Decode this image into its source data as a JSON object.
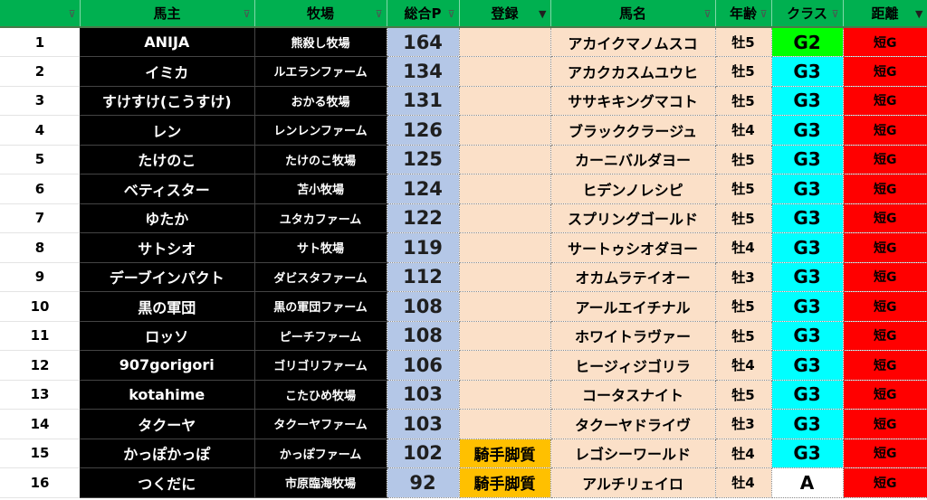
{
  "headers": [
    {
      "label": "",
      "filter": "normal"
    },
    {
      "label": "馬主",
      "filter": "normal"
    },
    {
      "label": "牧場",
      "filter": "normal"
    },
    {
      "label": "総合P",
      "filter": "normal"
    },
    {
      "label": "登録",
      "filter": "active"
    },
    {
      "label": "馬名",
      "filter": "normal"
    },
    {
      "label": "年齢",
      "filter": "normal"
    },
    {
      "label": "クラス",
      "filter": "normal"
    },
    {
      "label": "距離",
      "filter": "active"
    }
  ],
  "filter_icons": {
    "normal": "⊽",
    "active": "▼"
  },
  "class_colors": {
    "G2": "#00ff00",
    "G3": "#00ffff",
    "A": "#ffffff"
  },
  "rows": [
    {
      "idx": "1",
      "owner": "ANIJA",
      "farm": "熊殺し牧場",
      "points": "164",
      "registration": "",
      "horse": "アカイクマノムスコ",
      "age": "牡5",
      "class": "G2",
      "distance": "短G"
    },
    {
      "idx": "2",
      "owner": "イミカ",
      "farm": "ルエランファーム",
      "points": "134",
      "registration": "",
      "horse": "アカクカスムユウヒ",
      "age": "牡5",
      "class": "G3",
      "distance": "短G"
    },
    {
      "idx": "3",
      "owner": "すけすけ(こうすけ)",
      "farm": "おかる牧場",
      "points": "131",
      "registration": "",
      "horse": "ササキキングマコト",
      "age": "牡5",
      "class": "G3",
      "distance": "短G"
    },
    {
      "idx": "4",
      "owner": "レン",
      "farm": "レンレンファーム",
      "points": "126",
      "registration": "",
      "horse": "ブラッククラージュ",
      "age": "牡4",
      "class": "G3",
      "distance": "短G"
    },
    {
      "idx": "5",
      "owner": "たけのこ",
      "farm": "たけのこ牧場",
      "points": "125",
      "registration": "",
      "horse": "カーニバルダヨー",
      "age": "牡5",
      "class": "G3",
      "distance": "短G"
    },
    {
      "idx": "6",
      "owner": "ベティスター",
      "farm": "苫小牧場",
      "points": "124",
      "registration": "",
      "horse": "ヒデンノレシピ",
      "age": "牡5",
      "class": "G3",
      "distance": "短G"
    },
    {
      "idx": "7",
      "owner": "ゆたか",
      "farm": "ユタカファーム",
      "points": "122",
      "registration": "",
      "horse": "スプリングゴールド",
      "age": "牡5",
      "class": "G3",
      "distance": "短G"
    },
    {
      "idx": "8",
      "owner": "サトシオ",
      "farm": "サト牧場",
      "points": "119",
      "registration": "",
      "horse": "サートゥシオダヨー",
      "age": "牡4",
      "class": "G3",
      "distance": "短G"
    },
    {
      "idx": "9",
      "owner": "デーブインパクト",
      "farm": "ダビスタファーム",
      "points": "112",
      "registration": "",
      "horse": "オカムラテイオー",
      "age": "牡3",
      "class": "G3",
      "distance": "短G"
    },
    {
      "idx": "10",
      "owner": "黒の軍団",
      "farm": "黒の軍団ファーム",
      "points": "108",
      "registration": "",
      "horse": "アールエイチナル",
      "age": "牡5",
      "class": "G3",
      "distance": "短G"
    },
    {
      "idx": "11",
      "owner": "ロッソ",
      "farm": "ピーチファーム",
      "points": "108",
      "registration": "",
      "horse": "ホワイトラヴァー",
      "age": "牡5",
      "class": "G3",
      "distance": "短G"
    },
    {
      "idx": "12",
      "owner": "907gorigori",
      "farm": "ゴリゴリファーム",
      "points": "106",
      "registration": "",
      "horse": "ヒージィジゴリラ",
      "age": "牡4",
      "class": "G3",
      "distance": "短G"
    },
    {
      "idx": "13",
      "owner": "kotahime",
      "farm": "こたひめ牧場",
      "points": "103",
      "registration": "",
      "horse": "コータスナイト",
      "age": "牡5",
      "class": "G3",
      "distance": "短G"
    },
    {
      "idx": "14",
      "owner": "タクーヤ",
      "farm": "タクーヤファーム",
      "points": "103",
      "registration": "",
      "horse": "タクーヤドライヴ",
      "age": "牡3",
      "class": "G3",
      "distance": "短G"
    },
    {
      "idx": "15",
      "owner": "かっぽかっぽ",
      "farm": "かっぽファーム",
      "points": "102",
      "registration": "騎手脚質",
      "horse": "レゴシーワールド",
      "age": "牡4",
      "class": "G3",
      "distance": "短G"
    },
    {
      "idx": "16",
      "owner": "つくだに",
      "farm": "市原臨海牧場",
      "points": "92",
      "registration": "騎手脚質",
      "horse": "アルチリェイロ",
      "age": "牡4",
      "class": "A",
      "distance": "短G"
    }
  ]
}
